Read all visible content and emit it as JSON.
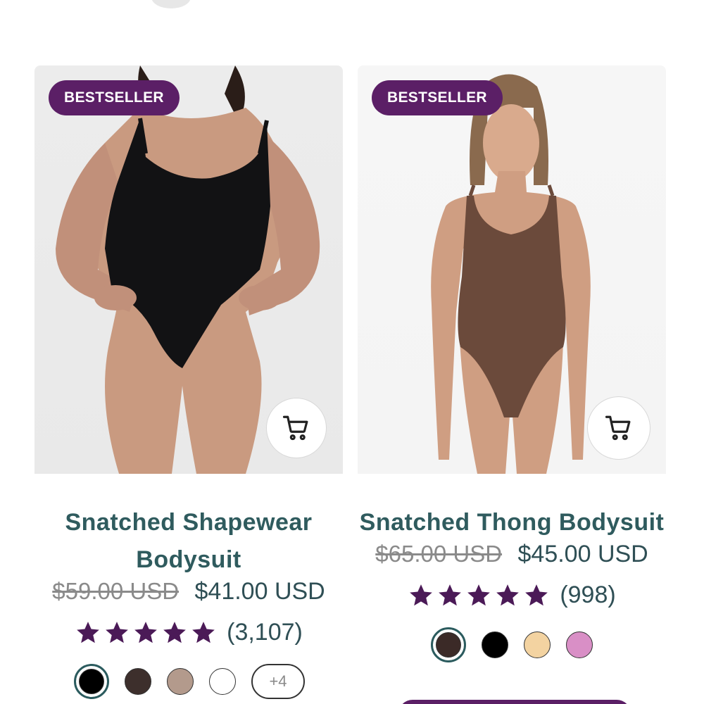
{
  "colors": {
    "brand_purple": "#5b1f66",
    "title_teal": "#2f5b5e",
    "price_text": "#2f4f55",
    "old_price": "#8a8a8a"
  },
  "products": [
    {
      "badge": "BESTSELLER",
      "title_line1": "Snatched Shapewear",
      "title_line2": "Bodysuit",
      "old_price": "$59.00 USD",
      "price": "$41.00 USD",
      "rating_stars": 5,
      "rating_count": "(3,107)",
      "cart_icon": "cart-icon",
      "swatches": [
        "#000000",
        "#3d2f2c",
        "#b39a8c",
        "#ffffff"
      ],
      "selected_swatch": 0,
      "more_colors": "+4"
    },
    {
      "badge": "BESTSELLER",
      "title_line1": "Snatched Thong Bodysuit",
      "old_price": "$65.00 USD",
      "price": "$45.00 USD",
      "rating_stars": 5,
      "rating_count": "(998)",
      "cart_icon": "cart-icon",
      "swatches": [
        "#3b2a27",
        "#000000",
        "#f3d3a1",
        "#d98fc6"
      ],
      "selected_swatch": 0
    }
  ]
}
